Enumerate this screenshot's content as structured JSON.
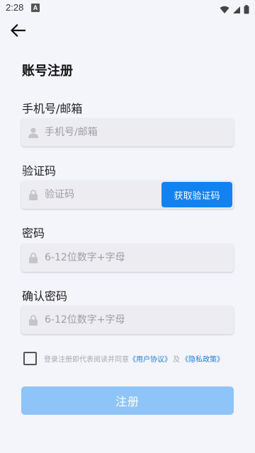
{
  "status_bar": {
    "time": "2:28",
    "notification_letter": "A"
  },
  "page": {
    "title": "账号注册"
  },
  "fields": {
    "account": {
      "label": "手机号/邮箱",
      "placeholder": "手机号/邮箱",
      "value": ""
    },
    "code": {
      "label": "验证码",
      "placeholder": "验证码",
      "value": "",
      "button_label": "获取验证码"
    },
    "password": {
      "label": "密码",
      "placeholder": "6-12位数字+字母",
      "value": ""
    },
    "confirm_password": {
      "label": "确认密码",
      "placeholder": "6-12位数字+字母",
      "value": ""
    }
  },
  "agreement": {
    "prefix": "登录注册即代表阅读并同意",
    "user_agreement": "《用户协议》",
    "conjunction": "及",
    "privacy_policy": "《隐私政策》",
    "checked": false
  },
  "submit": {
    "label": "注册"
  },
  "colors": {
    "primary": "#1282f0",
    "primary_disabled": "#8ec4f8",
    "link": "#1f7fd8",
    "background": "#f4f4fb",
    "input_bg": "#ececf1"
  }
}
